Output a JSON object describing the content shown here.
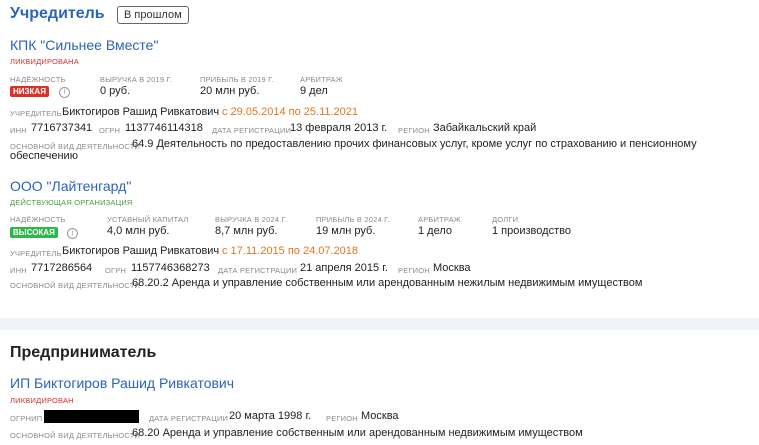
{
  "founder_section": {
    "title": "Учредитель",
    "past_badge": "В прошлом",
    "companies": [
      {
        "name": "КПК \"Сильнее Вместе\"",
        "status": "Ликвидирована",
        "reliability_label": "Надёжность",
        "reliability": "Низкая",
        "metrics": [
          {
            "label": "Выручка в 2019 г.",
            "value": "0 руб."
          },
          {
            "label": "Прибыль в 2019 г.",
            "value": "20 млн руб."
          },
          {
            "label": "Арбитраж",
            "value": "9 дел"
          }
        ],
        "founder_label": "Учредитель",
        "founder_name": "Биктогиров Рашид Ривкатович",
        "founder_period": "с 29.05.2014 по 25.11.2021",
        "inn_label": "ИНН",
        "inn": "7716737341",
        "ogrn_label": "ОГРН",
        "ogrn": "1137746114318",
        "reg_date_label": "Дата регистрации",
        "reg_date": "13 февраля 2013 г.",
        "region_label": "Регион",
        "region": "Забайкальский край",
        "activity_label": "Основной вид деятельности",
        "activity_line1": "64.9 Деятельность по предоставлению прочих финансовых услуг, кроме услуг по страхованию и пенсионному",
        "activity_line2": "обеспечению"
      },
      {
        "name": "ООО \"Лайтенгард\"",
        "status": "Действующая организация",
        "reliability_label": "Надёжность",
        "reliability": "Высокая",
        "metrics": [
          {
            "label": "Уставный капитал",
            "value": "4,0 млн руб."
          },
          {
            "label": "Выручка в 2024 г.",
            "value": "8,7 млн руб."
          },
          {
            "label": "Прибыль в 2024 г.",
            "value": "19 млн руб."
          },
          {
            "label": "Арбитраж",
            "value": "1 дело"
          },
          {
            "label": "Долги",
            "value": "1 производство"
          }
        ],
        "founder_label": "Учредитель",
        "founder_name": "Биктогиров Рашид Ривкатович",
        "founder_period": "с 17.11.2015 по 24.07.2018",
        "inn_label": "ИНН",
        "inn": "7717286564",
        "ogrn_label": "ОГРН",
        "ogrn": "1157746368273",
        "reg_date_label": "Дата регистрации",
        "reg_date": "21 апреля 2015 г.",
        "region_label": "Регион",
        "region": "Москва",
        "activity_label": "Основной вид деятельности",
        "activity_line1": "68.20.2 Аренда и управление собственным или арендованным нежилым недвижимым имуществом"
      }
    ]
  },
  "entrepreneur_section": {
    "title": "Предприниматель",
    "name": "ИП Биктогиров Рашид Ривкатович",
    "status": "Ликвидирован",
    "ogrnip_label": "ОГРНИП",
    "reg_date_label": "Дата регистрации",
    "reg_date": "20 марта 1998 г.",
    "region_label": "Регион",
    "region": "Москва",
    "activity_label": "Основной вид деятельности",
    "activity": "68.20 Аренда и управление собственным или арендованным недвижимым имуществом"
  },
  "icons": {
    "info": "info-icon"
  },
  "colors": {
    "link": "#2a65b8",
    "low_badge": "#d8322a",
    "high_badge": "#2fb84a",
    "period": "#e0771f"
  }
}
